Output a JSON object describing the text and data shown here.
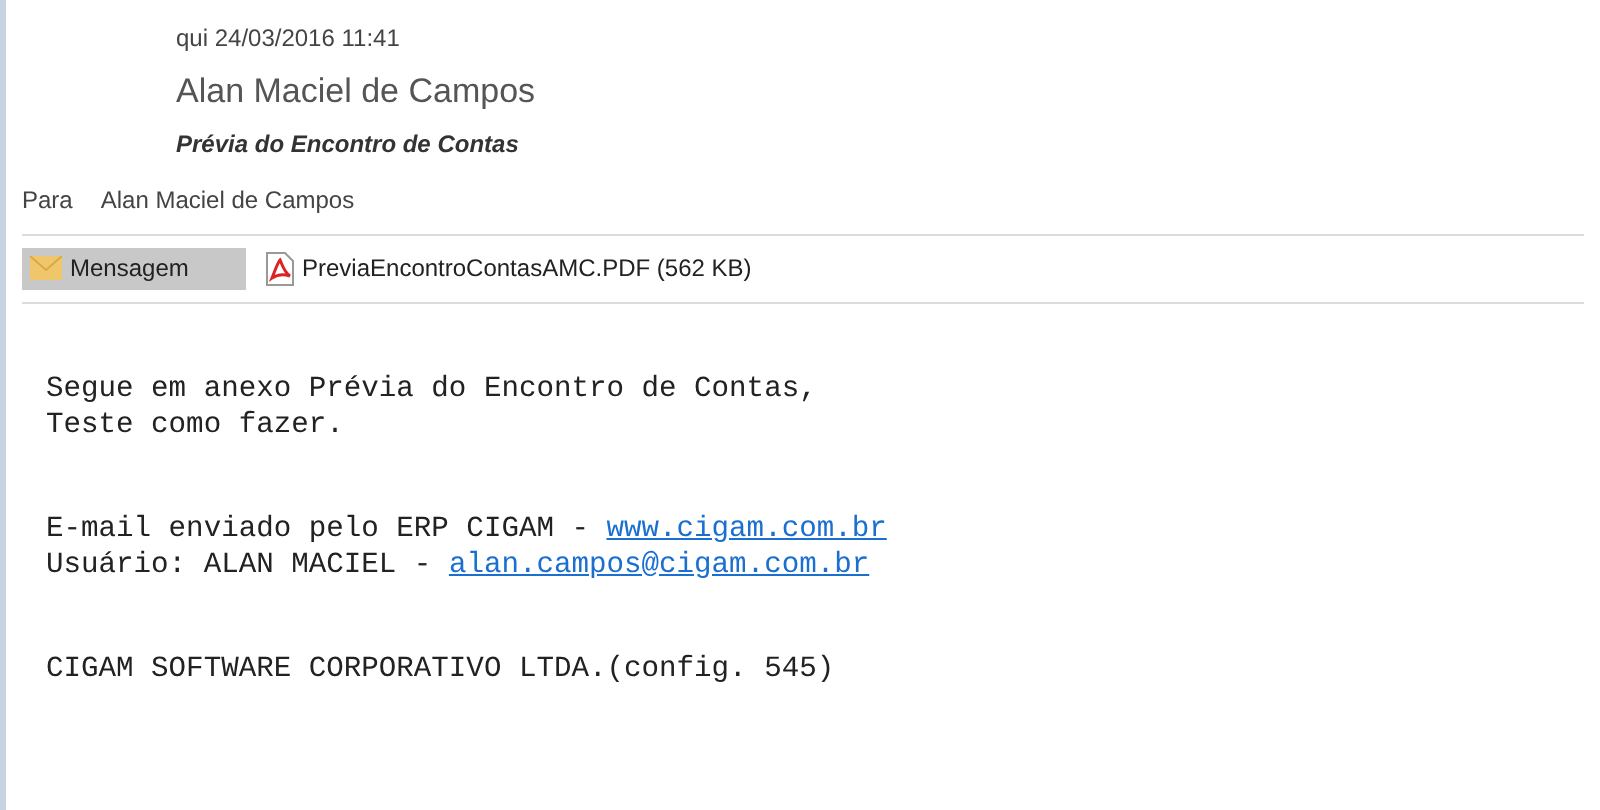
{
  "header": {
    "date": "qui 24/03/2016 11:41",
    "sender": "Alan Maciel de Campos",
    "subject": "Prévia do Encontro de Contas",
    "to_label": "Para",
    "to": "Alan Maciel de Campos"
  },
  "attachments": [
    {
      "kind": "message",
      "label": "Mensagem",
      "selected": true
    },
    {
      "kind": "pdf",
      "label": "PreviaEncontroContasAMC.PDF (562 KB)",
      "selected": false
    }
  ],
  "body": [
    {
      "lines": [
        {
          "text": "Segue em anexo Prévia do Encontro de Contas,"
        },
        {
          "text": "Teste como fazer."
        }
      ]
    },
    {
      "lines": [
        {
          "text": "E-mail enviado pelo ERP CIGAM - ",
          "link": "www.cigam.com.br"
        },
        {
          "text": "Usuário: ALAN MACIEL - ",
          "link": "alan.campos@cigam.com.br"
        }
      ]
    },
    {
      "lines": [
        {
          "text": "CIGAM SOFTWARE CORPORATIVO LTDA.(config. 545)"
        }
      ]
    }
  ]
}
